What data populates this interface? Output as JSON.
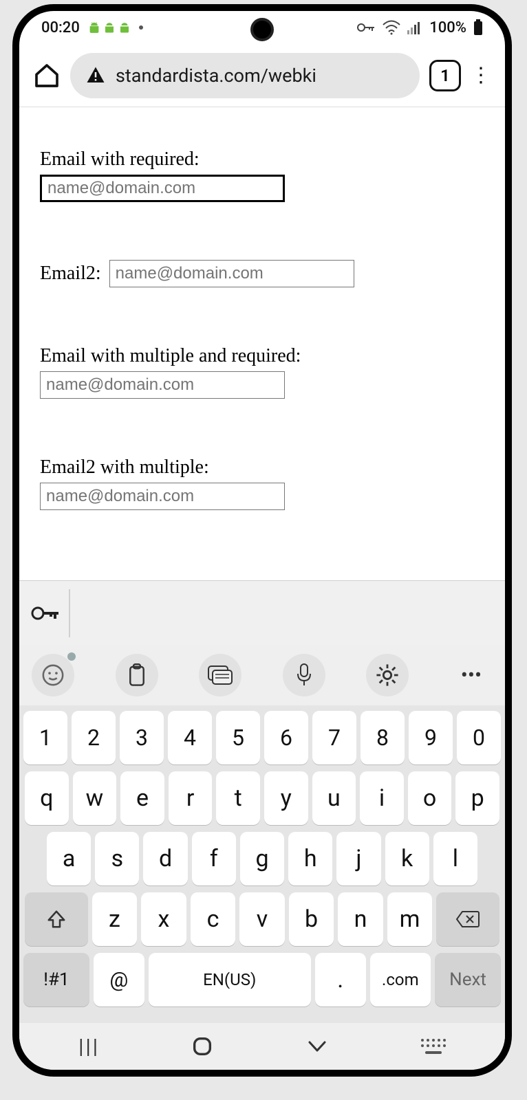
{
  "status": {
    "time": "00:20",
    "battery": "100%"
  },
  "browser": {
    "url": "standardista.com/webki",
    "tab_count": "1"
  },
  "form": {
    "f1": {
      "label": "Email with required:",
      "placeholder": "name@domain.com"
    },
    "f2": {
      "label": "Email2:",
      "placeholder": "name@domain.com"
    },
    "f3": {
      "label": "Email with multiple and required:",
      "placeholder": "name@domain.com"
    },
    "f4": {
      "label": "Email2 with multiple:",
      "placeholder": "name@domain.com"
    }
  },
  "keyboard": {
    "rows": {
      "num": [
        "1",
        "2",
        "3",
        "4",
        "5",
        "6",
        "7",
        "8",
        "9",
        "0"
      ],
      "r1": [
        "q",
        "w",
        "e",
        "r",
        "t",
        "y",
        "u",
        "i",
        "o",
        "p"
      ],
      "r2": [
        "a",
        "s",
        "d",
        "f",
        "g",
        "h",
        "j",
        "k",
        "l"
      ],
      "r3": [
        "z",
        "x",
        "c",
        "v",
        "b",
        "n",
        "m"
      ]
    },
    "sym": "!#1",
    "at": "@",
    "space": "EN(US)",
    "period": ".",
    "dotcom": ".com",
    "next": "Next"
  }
}
